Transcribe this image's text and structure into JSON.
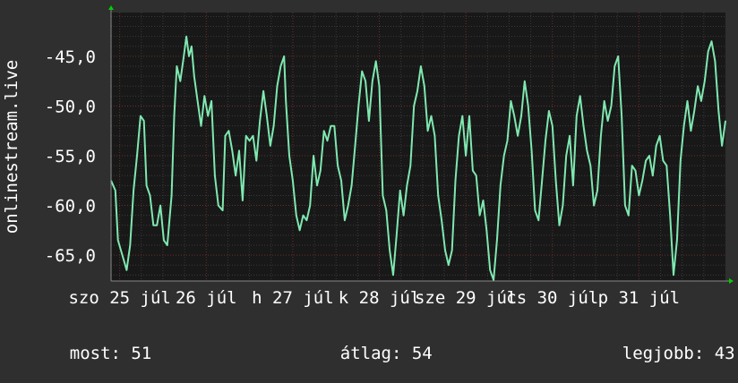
{
  "chart_data": {
    "type": "line",
    "ylabel": "onlinestream.live",
    "y_ticks": [
      "-45,0",
      "-50,0",
      "-55,0",
      "-60,0",
      "-65,0"
    ],
    "y_tick_values": [
      -45,
      -50,
      -55,
      -60,
      -65
    ],
    "ylim": [
      -67.6,
      -40.6
    ],
    "x_ticks": [
      "szo 25 júl",
      "26 júl",
      "h 27 júl",
      "k 28 júl",
      "sze 29 júl",
      "cs 30 júl",
      "p 31 júl"
    ],
    "x_tick_positions": [
      0.0,
      1.0,
      2.0,
      3.0,
      4.0,
      5.0,
      6.0
    ],
    "xlim": [
      -0.1,
      7.0
    ],
    "grid": true,
    "colors": {
      "background": "#2f2f2f",
      "plot_background": "#181818",
      "line": "#7fe8b0",
      "grid_major": "#6b2f2f",
      "grid_minor": "#3a3a3a",
      "axis": "#888888",
      "arrow": "#00d000"
    },
    "series": [
      {
        "values": [
          [
            -0.1,
            -57.5
          ],
          [
            -0.05,
            -58.5
          ],
          [
            -0.02,
            -63.5
          ],
          [
            0.03,
            -65.0
          ],
          [
            0.08,
            -66.5
          ],
          [
            0.12,
            -64.0
          ],
          [
            0.16,
            -58.5
          ],
          [
            0.2,
            -55.0
          ],
          [
            0.24,
            -51.0
          ],
          [
            0.28,
            -51.5
          ],
          [
            0.31,
            -58.0
          ],
          [
            0.35,
            -59.0
          ],
          [
            0.39,
            -62.0
          ],
          [
            0.43,
            -62.0
          ],
          [
            0.47,
            -60.0
          ],
          [
            0.51,
            -63.5
          ],
          [
            0.55,
            -64.0
          ],
          [
            0.6,
            -59.0
          ],
          [
            0.63,
            -51.0
          ],
          [
            0.66,
            -46.0
          ],
          [
            0.7,
            -47.5
          ],
          [
            0.74,
            -45.0
          ],
          [
            0.77,
            -43.0
          ],
          [
            0.8,
            -45.0
          ],
          [
            0.83,
            -44.0
          ],
          [
            0.86,
            -47.0
          ],
          [
            0.9,
            -49.5
          ],
          [
            0.94,
            -52.0
          ],
          [
            0.98,
            -49.0
          ],
          [
            1.02,
            -51.0
          ],
          [
            1.06,
            -49.5
          ],
          [
            1.1,
            -57.0
          ],
          [
            1.14,
            -60.0
          ],
          [
            1.19,
            -60.5
          ],
          [
            1.22,
            -53.0
          ],
          [
            1.26,
            -52.5
          ],
          [
            1.3,
            -54.5
          ],
          [
            1.34,
            -57.0
          ],
          [
            1.38,
            -54.5
          ],
          [
            1.42,
            -59.5
          ],
          [
            1.46,
            -53.0
          ],
          [
            1.5,
            -53.5
          ],
          [
            1.54,
            -53.0
          ],
          [
            1.58,
            -55.5
          ],
          [
            1.62,
            -51.5
          ],
          [
            1.66,
            -48.5
          ],
          [
            1.7,
            -51.0
          ],
          [
            1.74,
            -54.0
          ],
          [
            1.78,
            -52.0
          ],
          [
            1.82,
            -48.0
          ],
          [
            1.86,
            -46.0
          ],
          [
            1.9,
            -45.0
          ],
          [
            1.92,
            -49.5
          ],
          [
            1.96,
            -55.0
          ],
          [
            2.0,
            -57.5
          ],
          [
            2.04,
            -61.0
          ],
          [
            2.08,
            -62.5
          ],
          [
            2.12,
            -61.0
          ],
          [
            2.16,
            -61.5
          ],
          [
            2.2,
            -60.0
          ],
          [
            2.24,
            -55.0
          ],
          [
            2.28,
            -58.0
          ],
          [
            2.32,
            -56.5
          ],
          [
            2.36,
            -52.5
          ],
          [
            2.4,
            -53.5
          ],
          [
            2.44,
            -52.0
          ],
          [
            2.48,
            -52.0
          ],
          [
            2.52,
            -56.0
          ],
          [
            2.56,
            -57.5
          ],
          [
            2.6,
            -61.5
          ],
          [
            2.64,
            -60.0
          ],
          [
            2.68,
            -58.0
          ],
          [
            2.72,
            -54.0
          ],
          [
            2.76,
            -50.0
          ],
          [
            2.8,
            -46.5
          ],
          [
            2.84,
            -47.5
          ],
          [
            2.88,
            -51.5
          ],
          [
            2.92,
            -47.5
          ],
          [
            2.96,
            -45.5
          ],
          [
            3.0,
            -48.0
          ],
          [
            3.04,
            -59.0
          ],
          [
            3.08,
            -60.5
          ],
          [
            3.12,
            -64.5
          ],
          [
            3.16,
            -67.0
          ],
          [
            3.2,
            -63.0
          ],
          [
            3.24,
            -58.5
          ],
          [
            3.28,
            -61.0
          ],
          [
            3.32,
            -58.0
          ],
          [
            3.36,
            -56.0
          ],
          [
            3.4,
            -50.0
          ],
          [
            3.44,
            -48.5
          ],
          [
            3.48,
            -46.0
          ],
          [
            3.52,
            -48.0
          ],
          [
            3.56,
            -52.5
          ],
          [
            3.6,
            -51.0
          ],
          [
            3.64,
            -53.0
          ],
          [
            3.68,
            -59.0
          ],
          [
            3.72,
            -61.5
          ],
          [
            3.76,
            -64.5
          ],
          [
            3.8,
            -66.0
          ],
          [
            3.84,
            -64.5
          ],
          [
            3.88,
            -57.5
          ],
          [
            3.92,
            -53.0
          ],
          [
            3.96,
            -51.0
          ],
          [
            4.0,
            -55.0
          ],
          [
            4.04,
            -51.0
          ],
          [
            4.08,
            -56.5
          ],
          [
            4.12,
            -57.0
          ],
          [
            4.16,
            -61.0
          ],
          [
            4.2,
            -59.5
          ],
          [
            4.24,
            -62.5
          ],
          [
            4.28,
            -66.5
          ],
          [
            4.32,
            -67.5
          ],
          [
            4.36,
            -63.5
          ],
          [
            4.4,
            -58.0
          ],
          [
            4.44,
            -55.0
          ],
          [
            4.48,
            -53.5
          ],
          [
            4.52,
            -49.5
          ],
          [
            4.56,
            -51.0
          ],
          [
            4.6,
            -53.0
          ],
          [
            4.64,
            -51.0
          ],
          [
            4.68,
            -47.5
          ],
          [
            4.72,
            -50.0
          ],
          [
            4.76,
            -54.5
          ],
          [
            4.8,
            -60.5
          ],
          [
            4.84,
            -61.5
          ],
          [
            4.88,
            -57.5
          ],
          [
            4.92,
            -53.5
          ],
          [
            4.96,
            -50.5
          ],
          [
            5.0,
            -52.0
          ],
          [
            5.04,
            -57.5
          ],
          [
            5.08,
            -62.0
          ],
          [
            5.12,
            -60.0
          ],
          [
            5.16,
            -55.0
          ],
          [
            5.2,
            -53.0
          ],
          [
            5.24,
            -58.0
          ],
          [
            5.28,
            -51.0
          ],
          [
            5.32,
            -49.0
          ],
          [
            5.36,
            -52.0
          ],
          [
            5.4,
            -54.5
          ],
          [
            5.44,
            -56.0
          ],
          [
            5.48,
            -60.0
          ],
          [
            5.52,
            -58.5
          ],
          [
            5.56,
            -53.0
          ],
          [
            5.6,
            -49.5
          ],
          [
            5.64,
            -51.5
          ],
          [
            5.68,
            -50.0
          ],
          [
            5.72,
            -46.0
          ],
          [
            5.76,
            -45.0
          ],
          [
            5.8,
            -51.0
          ],
          [
            5.84,
            -60.0
          ],
          [
            5.88,
            -61.0
          ],
          [
            5.92,
            -56.0
          ],
          [
            5.96,
            -56.5
          ],
          [
            6.0,
            -59.0
          ],
          [
            6.04,
            -57.5
          ],
          [
            6.08,
            -55.5
          ],
          [
            6.12,
            -55.0
          ],
          [
            6.16,
            -57.0
          ],
          [
            6.2,
            -54.0
          ],
          [
            6.24,
            -53.0
          ],
          [
            6.28,
            -55.5
          ],
          [
            6.32,
            -56.0
          ],
          [
            6.36,
            -61.0
          ],
          [
            6.4,
            -67.0
          ],
          [
            6.44,
            -63.5
          ],
          [
            6.48,
            -55.5
          ],
          [
            6.52,
            -52.0
          ],
          [
            6.56,
            -49.5
          ],
          [
            6.6,
            -52.5
          ],
          [
            6.64,
            -50.5
          ],
          [
            6.68,
            -48.0
          ],
          [
            6.72,
            -49.5
          ],
          [
            6.76,
            -47.5
          ],
          [
            6.8,
            -44.5
          ],
          [
            6.84,
            -43.5
          ],
          [
            6.88,
            -45.5
          ],
          [
            6.92,
            -50.5
          ],
          [
            6.96,
            -54.0
          ],
          [
            7.0,
            -51.5
          ]
        ]
      }
    ]
  },
  "footer": {
    "current_label": "most:",
    "current_value": "51",
    "average_label": "átlag:",
    "average_value": "54",
    "best_label": "legjobb:",
    "best_value": "43"
  }
}
